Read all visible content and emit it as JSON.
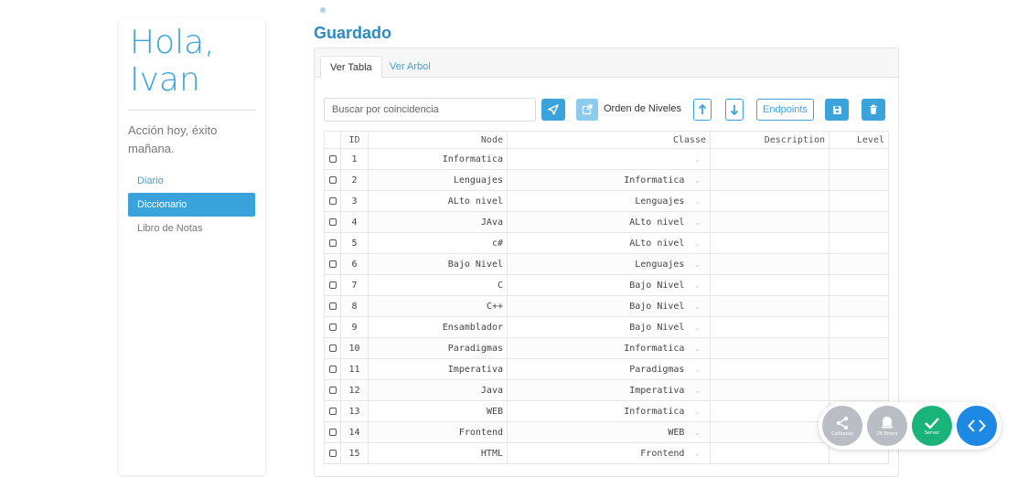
{
  "sidebar": {
    "greeting_line1": "Hola,",
    "greeting_line2": "Ivan",
    "motto": "Acción hoy, éxito mañana.",
    "nav": [
      {
        "label": "Diario"
      },
      {
        "label": "Diccionario"
      },
      {
        "label": "Libro de Notas"
      }
    ]
  },
  "main": {
    "title": "Guardado",
    "tabs": [
      {
        "label": "Ver Tabla"
      },
      {
        "label": "Ver Arbol"
      }
    ],
    "search_placeholder": "Buscar por coincidencia",
    "niveles_label": "Orden de Niveles",
    "endpoints_label": "Endpoints"
  },
  "table": {
    "columns": [
      "ID",
      "Node",
      "Classe",
      "Description",
      "Level"
    ],
    "rows": [
      {
        "id": "1",
        "node": "Informatica",
        "classe": "",
        "description": "",
        "level": ""
      },
      {
        "id": "2",
        "node": "Lenguajes",
        "classe": "Informatica",
        "description": "",
        "level": ""
      },
      {
        "id": "3",
        "node": "ALto nivel",
        "classe": "Lenguajes",
        "description": "",
        "level": ""
      },
      {
        "id": "4",
        "node": "JAva",
        "classe": "ALto nivel",
        "description": "",
        "level": ""
      },
      {
        "id": "5",
        "node": "c#",
        "classe": "ALto nivel",
        "description": "",
        "level": ""
      },
      {
        "id": "6",
        "node": "Bajo Nivel",
        "classe": "Lenguajes",
        "description": "",
        "level": ""
      },
      {
        "id": "7",
        "node": "C",
        "classe": "Bajo Nivel",
        "description": "",
        "level": ""
      },
      {
        "id": "8",
        "node": "C++",
        "classe": "Bajo Nivel",
        "description": "",
        "level": ""
      },
      {
        "id": "9",
        "node": "Ensamblador",
        "classe": "Bajo Nivel",
        "description": "",
        "level": ""
      },
      {
        "id": "10",
        "node": "Paradigmas",
        "classe": "Informatica",
        "description": "",
        "level": ""
      },
      {
        "id": "11",
        "node": "Imperativa",
        "classe": "Paradigmas",
        "description": "",
        "level": ""
      },
      {
        "id": "12",
        "node": "Java",
        "classe": "Imperativa",
        "description": "",
        "level": ""
      },
      {
        "id": "13",
        "node": "WEB",
        "classe": "Informatica",
        "description": "",
        "level": ""
      },
      {
        "id": "14",
        "node": "Frontend",
        "classe": "WEB",
        "description": "",
        "level": ""
      },
      {
        "id": "15",
        "node": "HTML",
        "classe": "Frontend",
        "description": "",
        "level": ""
      }
    ]
  },
  "dock": {
    "callbacks_label": "Callbacks",
    "errors_label": "35 Errors",
    "server_label": "Server"
  },
  "colors": {
    "accent": "#3aa3dc",
    "title": "#2d8bc4",
    "server": "#1ab37a",
    "muted_fab": "#b9bec5"
  }
}
